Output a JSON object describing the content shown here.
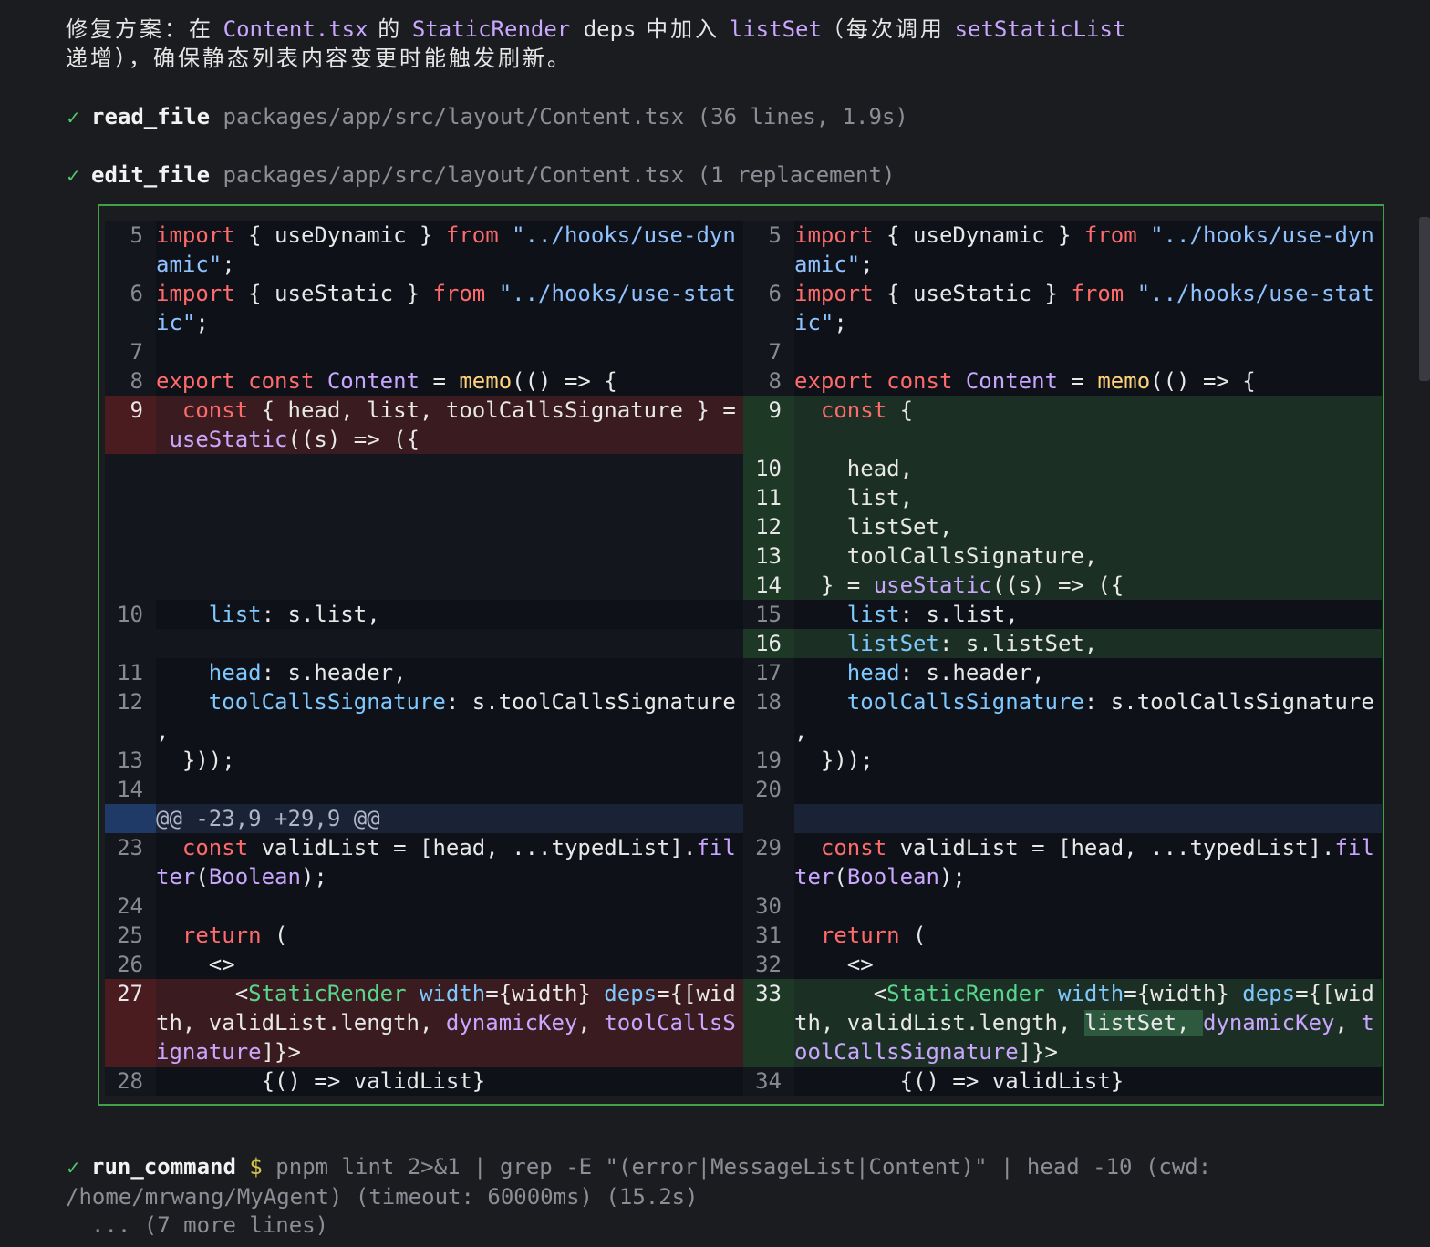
{
  "intro": {
    "p1": "修复方案：在 ",
    "c1": "Content.tsx",
    "p2": " 的 ",
    "c2": "StaticRender",
    "p3": " deps",
    "p4": " 中加入 ",
    "c3": "listSet",
    "p5": "（每次调用 ",
    "c4": "setStaticList",
    "p6": "\n递增），确保静态列表内容变更时能触发刷新。"
  },
  "tools": [
    {
      "icon": "✓",
      "name": "read_file",
      "args": " packages/app/src/layout/Content.tsx (36 lines, 1.9s)"
    },
    {
      "icon": "✓",
      "name": "edit_file",
      "args": " packages/app/src/layout/Content.tsx (1 replacement)"
    },
    {
      "icon": "✓",
      "name": "run_command",
      "dollar": " $",
      "args": " pnpm lint 2>&1 | grep -E \"(error|MessageList|Content)\" | head -10 (cwd:\n/home/mrwang/MyAgent) (timeout: 60000ms) (15.2s)"
    }
  ],
  "more_lines": "... (7 more lines)",
  "diff": {
    "hunk_header": "@@ -23,9 +29,9 @@",
    "left_nums": [
      "5",
      "6",
      "7",
      "8",
      "9",
      "10",
      "11",
      "12",
      "13",
      "14",
      "23",
      "24",
      "25",
      "26",
      "27",
      "28"
    ],
    "right_nums": [
      "5",
      "6",
      "7",
      "8",
      "9",
      "10",
      "11",
      "12",
      "13",
      "14",
      "15",
      "16",
      "17",
      "18",
      "19",
      "20",
      "29",
      "30",
      "31",
      "32",
      "33",
      "34"
    ]
  },
  "colors": {
    "added": "#1c2f24",
    "removed": "#3a1c20",
    "border": "#3fa048",
    "check": "#4ec96a"
  }
}
